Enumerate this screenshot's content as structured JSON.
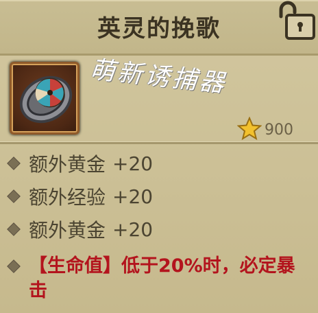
{
  "item": {
    "title": "英灵的挽歌",
    "watermark": "萌新诱捕器",
    "price": "900",
    "icons": {
      "lock": "unlocked-padlock-icon",
      "currency": "star-icon",
      "item": "ring-icon"
    },
    "stats": [
      {
        "label": "额外黄金",
        "value": "+20"
      },
      {
        "label": "额外经验",
        "value": "+20"
      },
      {
        "label": "额外黄金",
        "value": "+20"
      }
    ],
    "special_effect": "【生命值】低于20%时，必定暴击"
  },
  "colors": {
    "background": "#c8bd92",
    "title_text": "#3b3322",
    "special_text": "#b3141d",
    "star": "#f2c12e"
  }
}
